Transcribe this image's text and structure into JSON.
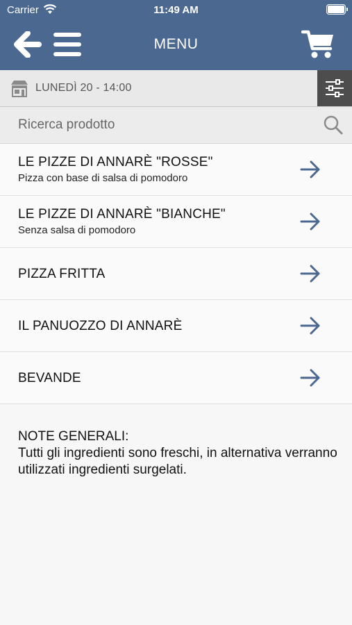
{
  "status_bar": {
    "carrier": "Carrier",
    "time": "11:49 AM"
  },
  "nav": {
    "title": "MENU",
    "back_icon": "arrow-left-icon",
    "menu_icon": "hamburger-icon",
    "cart_icon": "cart-icon"
  },
  "schedule": {
    "label": "LUNEDÌ 20 - 14:00",
    "icon": "shop-icon",
    "filter_icon": "sliders-icon"
  },
  "search": {
    "placeholder": "Ricerca prodotto",
    "value": "",
    "icon": "search-icon"
  },
  "categories": [
    {
      "title": "LE PIZZE DI ANNARÈ \"ROSSE\"",
      "subtitle": "Pizza con base di salsa di pomodoro"
    },
    {
      "title": "LE PIZZE DI ANNARÈ \"BIANCHE\"",
      "subtitle": "Senza salsa di pomodoro"
    },
    {
      "title": "PIZZA FRITTA",
      "subtitle": ""
    },
    {
      "title": "IL PANUOZZO DI ANNARÈ",
      "subtitle": ""
    },
    {
      "title": "BEVANDE",
      "subtitle": ""
    }
  ],
  "notes": {
    "heading": "NOTE GENERALI:",
    "body": "Tutti gli ingredienti sono freschi, in alternativa verranno utilizzati ingredienti surgelati."
  },
  "colors": {
    "header": "#4b6891",
    "arrow": "#4b6891",
    "filter_bg": "#4d4d4d"
  }
}
